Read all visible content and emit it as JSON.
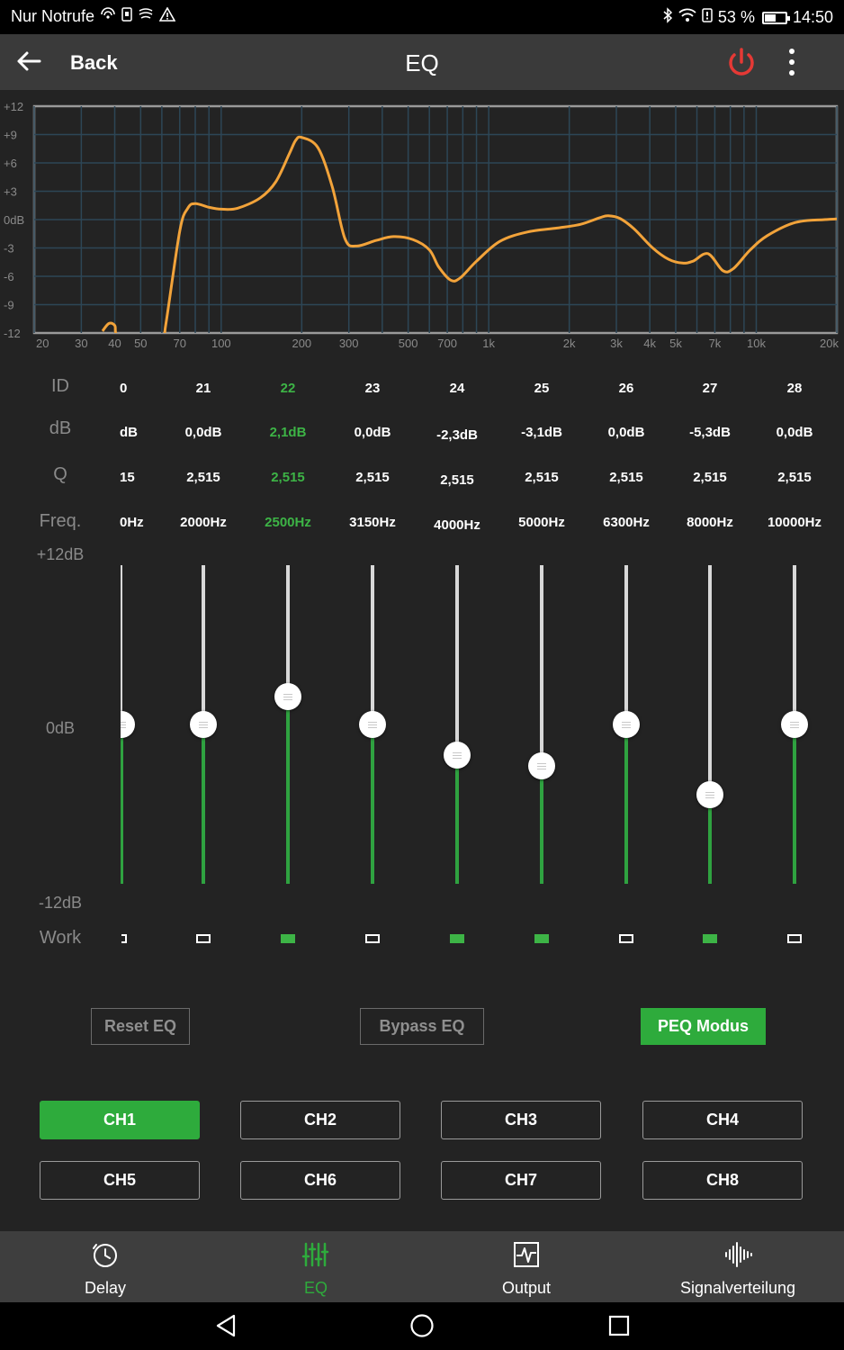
{
  "status_bar": {
    "carrier": "Nur Notrufe",
    "battery": "53 %",
    "battery_level": 0.53,
    "time": "14:50"
  },
  "app_bar": {
    "back_label": "Back",
    "title": "EQ"
  },
  "graph": {
    "db_ticks": [
      "+12",
      "+9",
      "+6",
      "+3",
      "0dB",
      "-3",
      "-6",
      "-9",
      "-12"
    ],
    "freq_ticks": [
      "20",
      "30",
      "40",
      "50",
      "70",
      "100",
      "200",
      "300",
      "500",
      "700",
      "1k",
      "2k",
      "3k",
      "4k",
      "5k",
      "7k",
      "10k",
      "20k"
    ],
    "curve_color": "#f2a33a"
  },
  "row_labels": {
    "id": "ID",
    "db": "dB",
    "q": "Q",
    "freq": "Freq."
  },
  "bands": [
    {
      "id": "0",
      "db": "dB",
      "q": "15",
      "freq": "0Hz",
      "gain": 0.0,
      "active": false,
      "work": false,
      "partial": true
    },
    {
      "id": "21",
      "db": "0,0dB",
      "q": "2,515",
      "freq": "2000Hz",
      "gain": 0.0,
      "active": false,
      "work": false
    },
    {
      "id": "22",
      "db": "2,1dB",
      "q": "2,515",
      "freq": "2500Hz",
      "gain": 2.1,
      "active": true,
      "work": true
    },
    {
      "id": "23",
      "db": "0,0dB",
      "q": "2,515",
      "freq": "3150Hz",
      "gain": 0.0,
      "active": false,
      "work": false
    },
    {
      "id": "24",
      "db": "-2,3dB",
      "q": "2,515",
      "freq": "4000Hz",
      "gain": -2.3,
      "active": false,
      "work": true
    },
    {
      "id": "25",
      "db": "-3,1dB",
      "q": "2,515",
      "freq": "5000Hz",
      "gain": -3.1,
      "active": false,
      "work": true
    },
    {
      "id": "26",
      "db": "0,0dB",
      "q": "2,515",
      "freq": "6300Hz",
      "gain": 0.0,
      "active": false,
      "work": false
    },
    {
      "id": "27",
      "db": "-5,3dB",
      "q": "2,515",
      "freq": "8000Hz",
      "gain": -5.3,
      "active": false,
      "work": true
    },
    {
      "id": "28",
      "db": "0,0dB",
      "q": "2,515",
      "freq": "10000Hz",
      "gain": 0.0,
      "active": false,
      "work": false
    }
  ],
  "slider_labels": {
    "top": "+12dB",
    "mid": "0dB",
    "bottom": "-12dB",
    "work": "Work"
  },
  "actions": {
    "reset": "Reset EQ",
    "bypass": "Bypass EQ",
    "peq": "PEQ Modus"
  },
  "channels": [
    "CH1",
    "CH2",
    "CH3",
    "CH4",
    "CH5",
    "CH6",
    "CH7",
    "CH8"
  ],
  "selected_channel": "CH1",
  "bottom_nav": {
    "delay": "Delay",
    "eq": "EQ",
    "output": "Output",
    "signal": "Signalverteilung"
  },
  "colors": {
    "accent_green": "#2eab3c",
    "power_red": "#e53935",
    "curve_orange": "#f2a33a"
  }
}
